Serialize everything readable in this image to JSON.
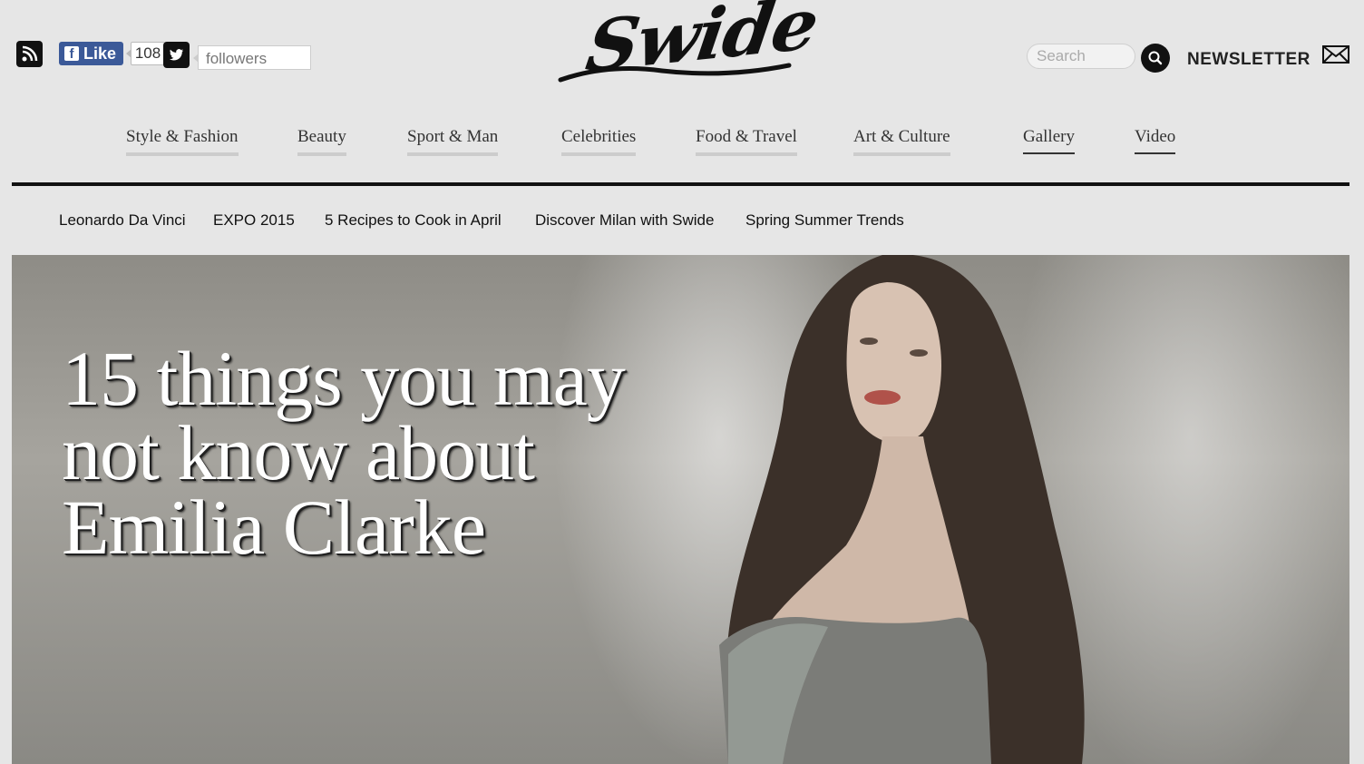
{
  "header": {
    "rss_icon": "rss-icon",
    "facebook": {
      "like_label": "Like",
      "like_count": "108"
    },
    "twitter": {
      "followers_label": "followers"
    },
    "logo_text": "Swide",
    "search": {
      "placeholder": "Search"
    },
    "newsletter_label": "NEWSLETTER"
  },
  "nav": {
    "items": [
      {
        "label": "Style & Fashion"
      },
      {
        "label": "Beauty"
      },
      {
        "label": "Sport & Man"
      },
      {
        "label": "Celebrities"
      },
      {
        "label": "Food & Travel"
      },
      {
        "label": "Art & Culture"
      },
      {
        "label": "Gallery"
      },
      {
        "label": "Video"
      }
    ]
  },
  "trending": {
    "items": [
      {
        "label": "Leonardo Da Vinci"
      },
      {
        "label": "EXPO 2015"
      },
      {
        "label": "5 Recipes to Cook in April"
      },
      {
        "label": "Discover Milan with Swide"
      },
      {
        "label": "Spring Summer Trends"
      }
    ]
  },
  "hero": {
    "headline_line1": "15 things you may",
    "headline_line2": "not know about",
    "headline_line3": "Emilia Clarke"
  },
  "colors": {
    "background": "#e6e6e6",
    "facebook_blue": "#3b5998",
    "rule": "#111111"
  }
}
